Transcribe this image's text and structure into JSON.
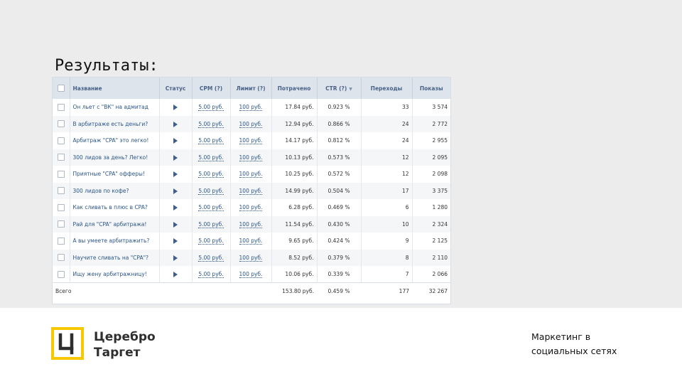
{
  "slide": {
    "title": "Результаты:",
    "brand_line1": "Церебро",
    "brand_line2": "Таргет",
    "tagline_line1": "Маркетинг в",
    "tagline_line2": "социальных сетях",
    "accent_color": "#f5c800"
  },
  "table": {
    "headers": {
      "name": "Название",
      "status": "Статус",
      "cpm": "CPM (?)",
      "limit": "Лимит (?)",
      "spent": "Потрачено",
      "ctr": "CTR (?)",
      "clicks": "Переходы",
      "shows": "Показы"
    },
    "rows": [
      {
        "name": "Он льет с \"ВК\" на адмитад",
        "cpm": "5.00 руб.",
        "limit": "100 руб.",
        "spent": "17.84 руб.",
        "ctr": "0.923 %",
        "clicks": "33",
        "shows": "3 574"
      },
      {
        "name": "В арбитраже есть деньги?",
        "cpm": "5.00 руб.",
        "limit": "100 руб.",
        "spent": "12.94 руб.",
        "ctr": "0.866 %",
        "clicks": "24",
        "shows": "2 772"
      },
      {
        "name": "Арбитраж \"CPA\" это легко!",
        "cpm": "5.00 руб.",
        "limit": "100 руб.",
        "spent": "14.17 руб.",
        "ctr": "0.812 %",
        "clicks": "24",
        "shows": "2 955"
      },
      {
        "name": "300 лидов за день? Легко!",
        "cpm": "5.00 руб.",
        "limit": "100 руб.",
        "spent": "10.13 руб.",
        "ctr": "0.573 %",
        "clicks": "12",
        "shows": "2 095"
      },
      {
        "name": "Приятные \"CPA\" офферы!",
        "cpm": "5.00 руб.",
        "limit": "100 руб.",
        "spent": "10.25 руб.",
        "ctr": "0.572 %",
        "clicks": "12",
        "shows": "2 098"
      },
      {
        "name": "300 лидов по кофе?",
        "cpm": "5.00 руб.",
        "limit": "100 руб.",
        "spent": "14.99 руб.",
        "ctr": "0.504 %",
        "clicks": "17",
        "shows": "3 375"
      },
      {
        "name": "Как сливать в плюс в CPA?",
        "cpm": "5.00 руб.",
        "limit": "100 руб.",
        "spent": "6.28 руб.",
        "ctr": "0.469 %",
        "clicks": "6",
        "shows": "1 280"
      },
      {
        "name": "Рай для \"CPA\" арбитража!",
        "cpm": "5.00 руб.",
        "limit": "100 руб.",
        "spent": "11.54 руб.",
        "ctr": "0.430 %",
        "clicks": "10",
        "shows": "2 324"
      },
      {
        "name": "А вы умеете арбитражить?",
        "cpm": "5.00 руб.",
        "limit": "100 руб.",
        "spent": "9.65 руб.",
        "ctr": "0.424 %",
        "clicks": "9",
        "shows": "2 125"
      },
      {
        "name": "Научите сливать на \"CPA\"?",
        "cpm": "5.00 руб.",
        "limit": "100 руб.",
        "spent": "8.52 руб.",
        "ctr": "0.379 %",
        "clicks": "8",
        "shows": "2 110"
      },
      {
        "name": "Ищу жену арбитражницу!",
        "cpm": "5.00 руб.",
        "limit": "100 руб.",
        "spent": "10.06 руб.",
        "ctr": "0.339 %",
        "clicks": "7",
        "shows": "2 066"
      }
    ],
    "total": {
      "label": "Всего",
      "spent": "153.80 руб.",
      "ctr": "0.459 %",
      "clicks": "177",
      "shows": "32 267"
    }
  }
}
